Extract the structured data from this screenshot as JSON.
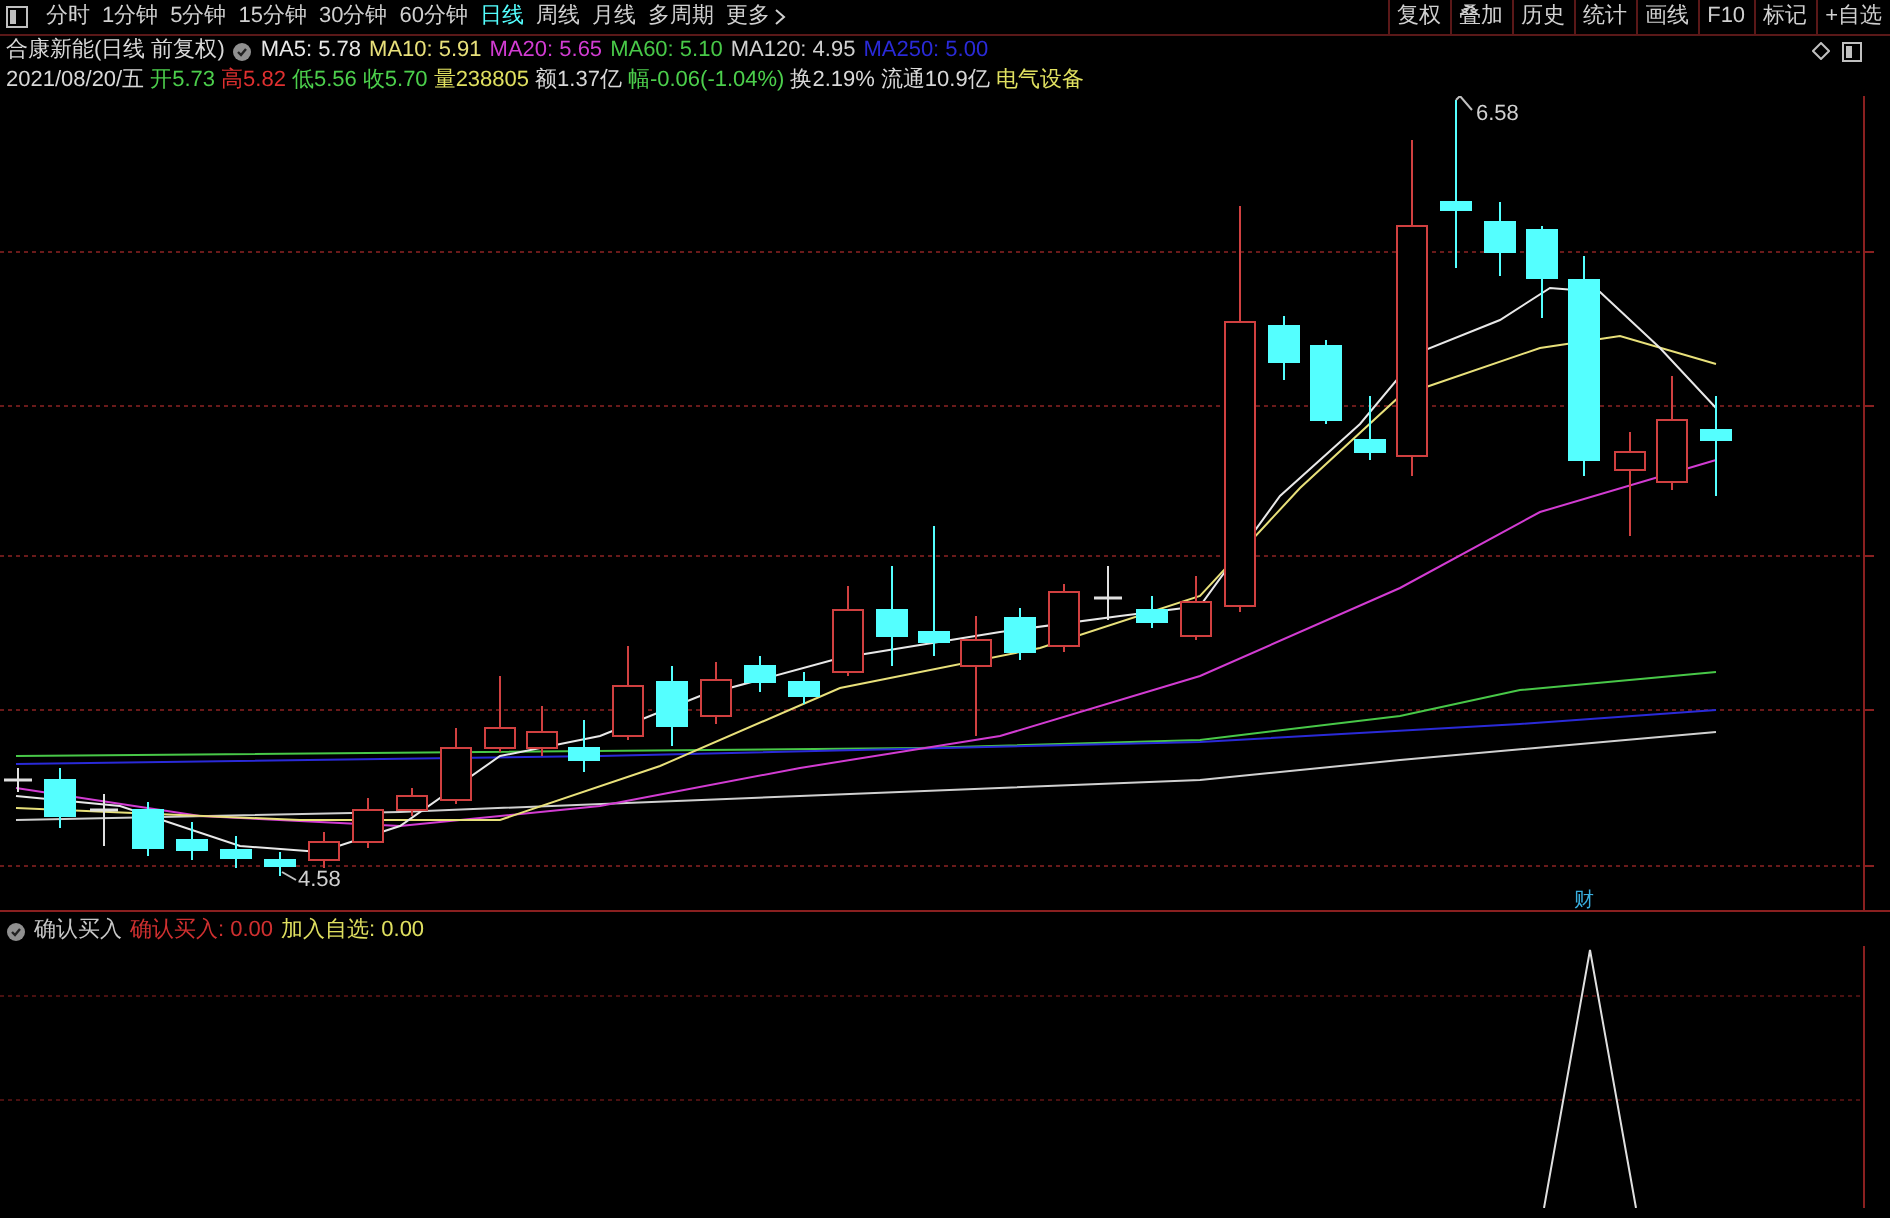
{
  "toolbar": {
    "periods": [
      {
        "label": "分时",
        "selected": false
      },
      {
        "label": "1分钟",
        "selected": false
      },
      {
        "label": "5分钟",
        "selected": false
      },
      {
        "label": "15分钟",
        "selected": false
      },
      {
        "label": "30分钟",
        "selected": false
      },
      {
        "label": "60分钟",
        "selected": false
      },
      {
        "label": "日线",
        "selected": true
      },
      {
        "label": "周线",
        "selected": false
      },
      {
        "label": "月线",
        "selected": false
      },
      {
        "label": "多周期",
        "selected": false
      }
    ],
    "more": "更多",
    "actions": [
      "复权",
      "叠加",
      "历史",
      "统计",
      "画线",
      "F10",
      "标记",
      "+自选"
    ]
  },
  "info": {
    "stock": "合康新能(日线 前复权)",
    "moving_averages": [
      {
        "text": "MA5: 5.78",
        "color": "#e8e8e8"
      },
      {
        "text": "MA10: 5.91",
        "color": "#e8e07a"
      },
      {
        "text": "MA20: 5.65",
        "color": "#d23cd2"
      },
      {
        "text": "MA60: 5.10",
        "color": "#48c848"
      },
      {
        "text": "MA120: 4.95",
        "color": "#d0d0d0"
      },
      {
        "text": "MA250: 5.00",
        "color": "#2a2ad8"
      }
    ],
    "quote": [
      {
        "text": "2021/08/20/五",
        "color": "#d8d8d8"
      },
      {
        "text": "开5.73",
        "color": "#4ccf4c"
      },
      {
        "text": "高5.82",
        "color": "#e03030"
      },
      {
        "text": "低5.56",
        "color": "#4ccf4c"
      },
      {
        "text": "收5.70",
        "color": "#4ccf4c"
      },
      {
        "text": "量238805",
        "color": "#e0e060"
      },
      {
        "text": "额1.37亿",
        "color": "#d8d8d8"
      },
      {
        "text": "幅-0.06(-1.04%)",
        "color": "#4ccf4c"
      },
      {
        "text": "换2.19%",
        "color": "#d8d8d8"
      },
      {
        "text": "流通10.9亿",
        "color": "#d8d8d8"
      },
      {
        "text": "电气设备",
        "color": "#e0e060"
      }
    ]
  },
  "chart": {
    "high_label": "6.58",
    "low_label": "4.58",
    "marker": "财"
  },
  "indicator": {
    "name": "确认买入",
    "values": [
      {
        "text": "确认买入: 0.00",
        "color": "#d03030"
      },
      {
        "text": "加入自选: 0.00",
        "color": "#e0e060"
      }
    ]
  }
}
